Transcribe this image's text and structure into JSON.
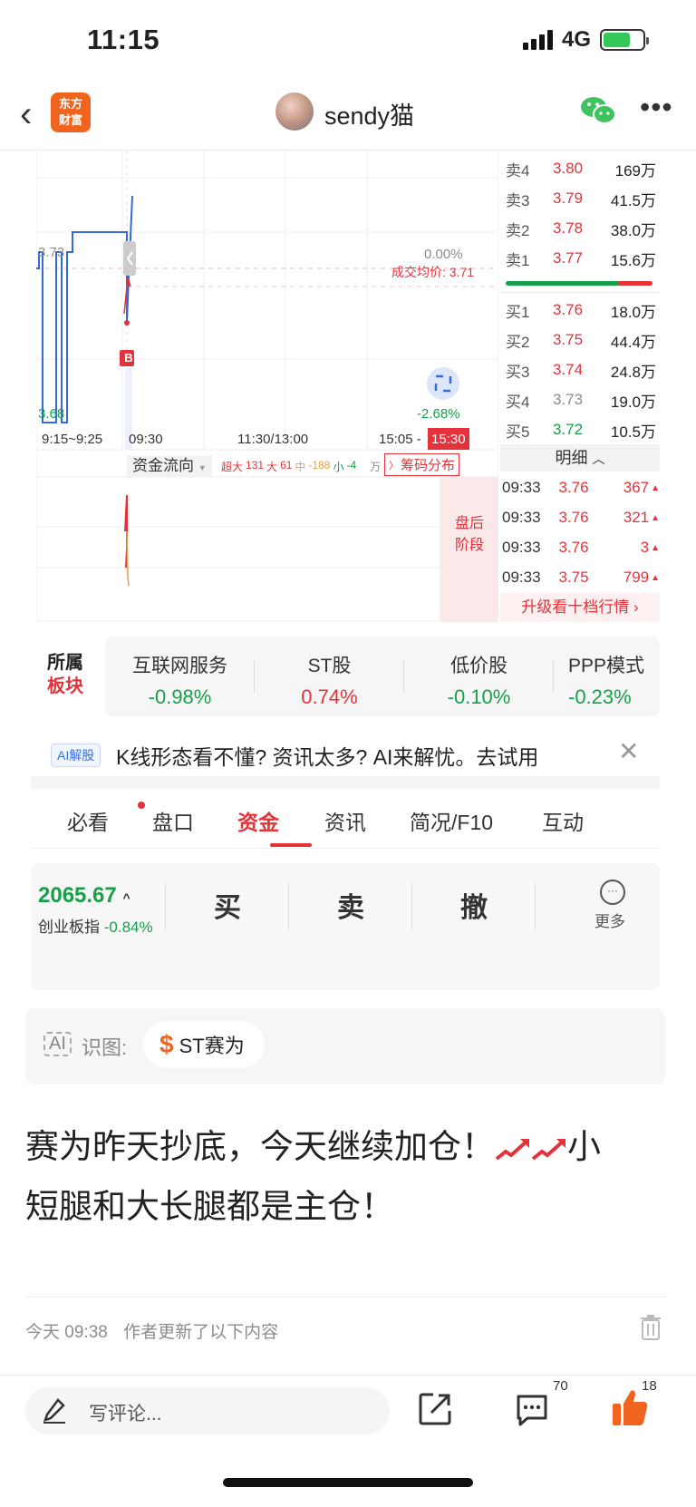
{
  "status": {
    "time": "11:15",
    "network": "4G"
  },
  "nav": {
    "logo_line1": "东方",
    "logo_line2": "财富",
    "title": "sendy猫"
  },
  "chart": {
    "price_label_top": "3.73",
    "price_label_bottom": "3.68",
    "pct_zero": "0.00%",
    "avg_price_label": "成交均价: 3.71",
    "pct_low": "-2.68%",
    "buy_marker": "B",
    "x_ticks": [
      "9:15~9:25",
      "09:30",
      "11:30/13:00",
      "15:05 -",
      "15:30"
    ],
    "fund_flow_tab": "资金流向",
    "flow_items": [
      {
        "label": "超大",
        "value": "131"
      },
      {
        "label": "大",
        "value": "61"
      },
      {
        "label": "中",
        "value": "-188"
      },
      {
        "label": "小",
        "value": "-4"
      }
    ],
    "flow_unit": "万",
    "chip_button": "筹码分布",
    "after_hours": [
      "盘后",
      "阶段"
    ]
  },
  "order_book": {
    "asks": [
      {
        "label": "卖4",
        "price": "3.80",
        "vol": "169万"
      },
      {
        "label": "卖3",
        "price": "3.79",
        "vol": "41.5万"
      },
      {
        "label": "卖2",
        "price": "3.78",
        "vol": "38.0万"
      },
      {
        "label": "卖1",
        "price": "3.77",
        "vol": "15.6万"
      }
    ],
    "bids": [
      {
        "label": "买1",
        "price": "3.76",
        "vol": "18.0万",
        "color": "red"
      },
      {
        "label": "买2",
        "price": "3.75",
        "vol": "44.4万",
        "color": "red"
      },
      {
        "label": "买3",
        "price": "3.74",
        "vol": "24.8万",
        "color": "red"
      },
      {
        "label": "买4",
        "price": "3.73",
        "vol": "19.0万",
        "color": "gray"
      },
      {
        "label": "买5",
        "price": "3.72",
        "vol": "10.5万",
        "color": "green"
      }
    ],
    "detail_header": "明细",
    "ticks": [
      {
        "time": "09:33",
        "price": "3.76",
        "vol": "367"
      },
      {
        "time": "09:33",
        "price": "3.76",
        "vol": "321"
      },
      {
        "time": "09:33",
        "price": "3.76",
        "vol": "3"
      },
      {
        "time": "09:33",
        "price": "3.75",
        "vol": "799"
      }
    ],
    "upgrade_link": "升级看十档行情"
  },
  "sectors": {
    "label_line1": "所属",
    "label_line2": "板块",
    "items": [
      {
        "name": "互联网服务",
        "change": "-0.98%",
        "color": "green"
      },
      {
        "name": "ST股",
        "change": "0.74%",
        "color": "red"
      },
      {
        "name": "低价股",
        "change": "-0.10%",
        "color": "green"
      },
      {
        "name": "PPP模式",
        "change": "-0.23%",
        "color": "green"
      }
    ]
  },
  "ai_banner": {
    "tag": "AI解股",
    "text": "K线形态看不懂? 资讯太多? AI来解忧。去试用"
  },
  "tabs": [
    "必看",
    "盘口",
    "资金",
    "资讯",
    "简况/F10",
    "互动"
  ],
  "trade": {
    "index_value": "2065.67",
    "index_name": "创业板指",
    "index_change": "-0.84%",
    "buy": "买",
    "sell": "卖",
    "cancel": "撤",
    "more": "更多"
  },
  "recognize": {
    "icon_text": "AI",
    "label": "识图:",
    "stock": "ST赛为"
  },
  "post": {
    "line1": "赛为昨天抄底，今天继续加仓！",
    "line1_tail": "小",
    "line2": "短腿和大长腿都是主仓！"
  },
  "meta": {
    "time": "今天 09:38",
    "note": "作者更新了以下内容"
  },
  "bottom": {
    "comment_placeholder": "写评论...",
    "comment_count": "70",
    "like_count": "18"
  },
  "colors": {
    "red": "#e5323a",
    "green": "#17a04a",
    "brand": "#f1641e"
  }
}
